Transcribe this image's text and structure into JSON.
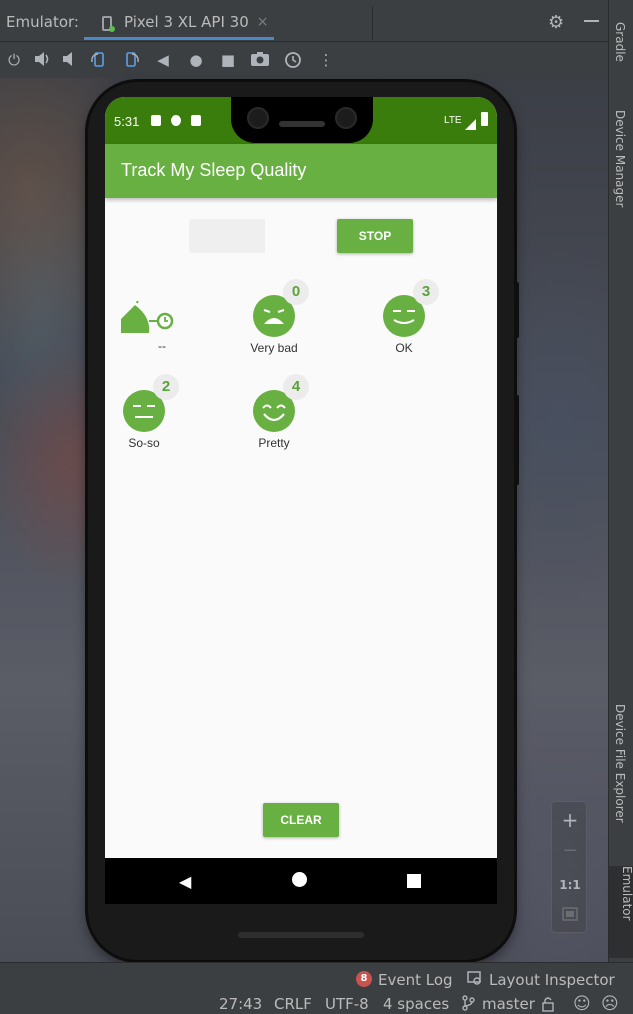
{
  "ide": {
    "tab_label": "Emulator:",
    "device_tab": "Pixel 3 XL API 30",
    "close_glyph": "×",
    "settings_icon": "gear-icon",
    "side_tabs": {
      "gradle": "Gradle",
      "device_manager": "Device Manager",
      "device_file_explorer": "Device File Explorer",
      "emulator": "Emulator"
    },
    "zoom": {
      "plus": "+",
      "minus": "−",
      "ratio": "1:1"
    },
    "status": {
      "event_count": "8",
      "event_log": "Event Log",
      "layout_inspector": "Layout Inspector",
      "position": "27:43",
      "line_sep": "CRLF",
      "encoding": "UTF-8",
      "indent": "4 spaces",
      "branch": "master"
    }
  },
  "device": {
    "time": "5:31",
    "network": "LTE",
    "app_title": "Track My Sleep Quality",
    "start_label": "",
    "stop_label": "STOP",
    "clear_label": "CLEAR",
    "nights": [
      {
        "quality": "",
        "label": "--",
        "icon": "sleep-active-icon"
      },
      {
        "quality": "0",
        "label": "Very bad",
        "icon": "very-bad-face-icon"
      },
      {
        "quality": "3",
        "label": "OK",
        "icon": "ok-face-icon"
      },
      {
        "quality": "2",
        "label": "So-so",
        "icon": "so-so-face-icon"
      },
      {
        "quality": "4",
        "label": "Pretty",
        "icon": "pretty-face-icon"
      }
    ]
  },
  "colors": {
    "accent_green": "#67b041",
    "status_bar_green": "#3a7d0c",
    "ide_background": "#3c3f41",
    "tab_underline": "#4a88c7"
  }
}
